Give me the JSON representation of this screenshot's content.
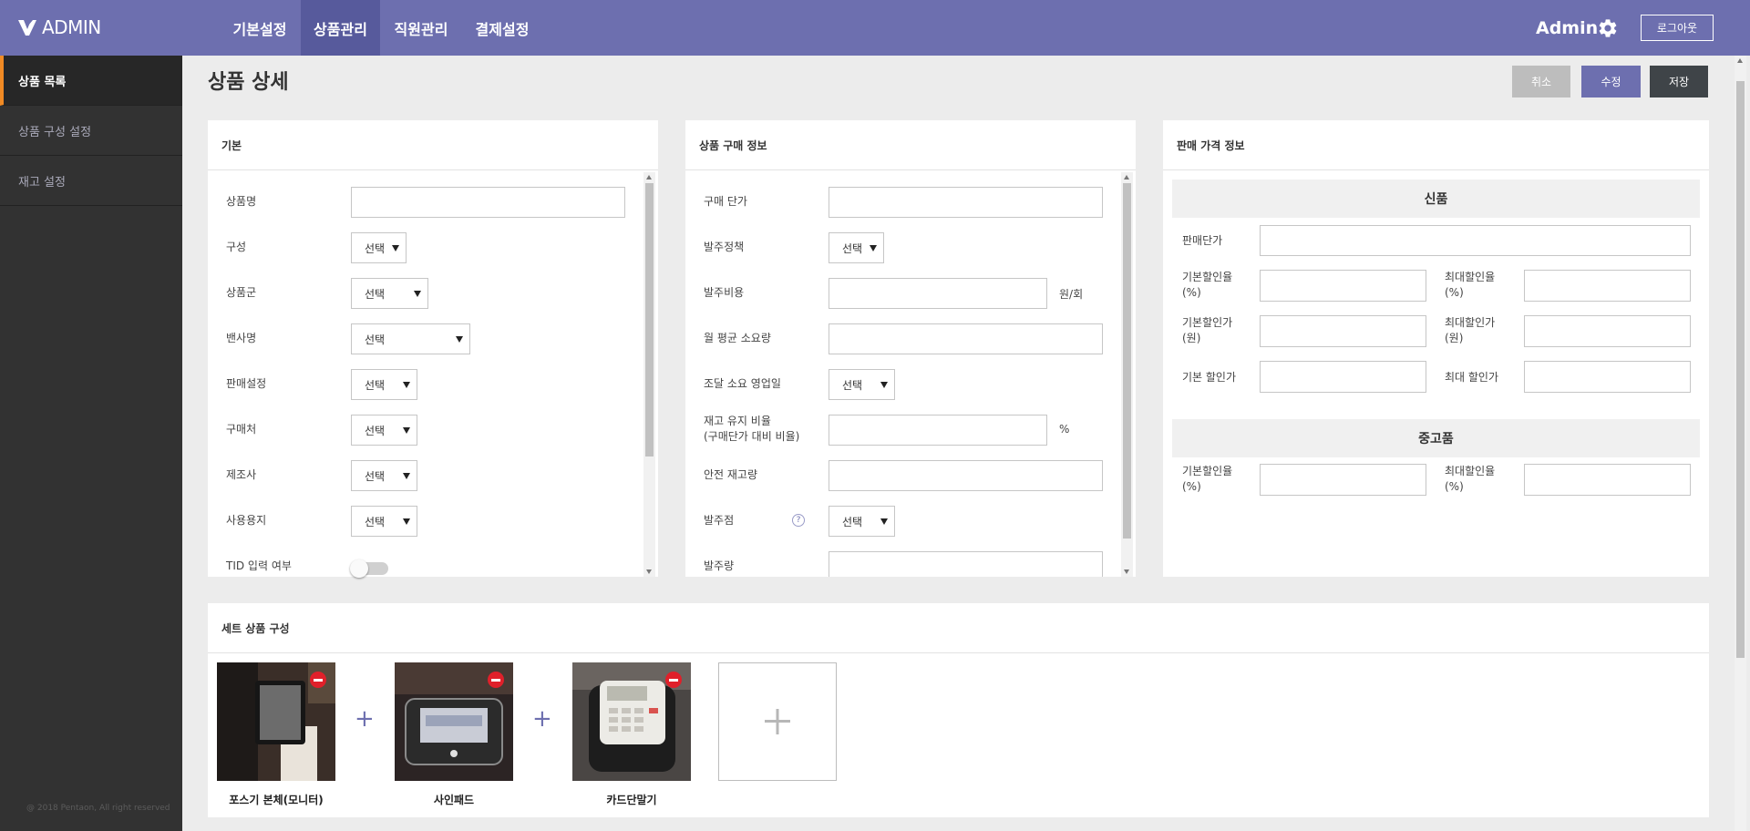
{
  "header": {
    "logo_text": "ADMIN",
    "nav": [
      {
        "label": "기본설정"
      },
      {
        "label": "상품관리"
      },
      {
        "label": "직원관리"
      },
      {
        "label": "결제설정"
      }
    ],
    "active_nav": "상품관리",
    "user_name": "Admin",
    "logout_label": "로그아웃",
    "colors": {
      "topbar": "#6d6faf",
      "active_nav": "#575a9c"
    }
  },
  "sidebar": {
    "items": [
      {
        "label": "상품 목록"
      },
      {
        "label": "상품 구성 설정"
      },
      {
        "label": "재고 설정"
      }
    ],
    "active_item": "상품 목록",
    "accent_color": "#f08a24",
    "copyright": "@ 2018 Pentaon, All right reserved"
  },
  "page": {
    "title": "상품 상세",
    "buttons": {
      "cancel": "취소",
      "edit": "수정",
      "save": "저장"
    },
    "button_colors": {
      "cancel": "#bdbdbd",
      "edit": "#6d6faf",
      "save": "#3f4448"
    }
  },
  "basic": {
    "title": "기본",
    "name_label": "상품명",
    "composition_label": "구성",
    "group_label": "상품군",
    "vendor_label": "밴사명",
    "sale_label": "판매설정",
    "purchase_label": "구매처",
    "maker_label": "제조사",
    "usage_label": "사용용지",
    "tid_label": "TID 입력 여부",
    "select_placeholder": "선택",
    "tid_enabled": false
  },
  "purchase": {
    "title": "상품 구매 정보",
    "unit_price_label": "구매 단가",
    "order_policy_label": "발주정책",
    "order_cost_label": "발주비용",
    "order_cost_unit": "원/회",
    "monthly_usage_label": "월 평균 소요량",
    "lead_days_label": "조달 소요 영업일",
    "stock_ratio_label_1": "재고 유지 비율",
    "stock_ratio_label_2": "(구매단가 대비 비율)",
    "stock_ratio_unit": "%",
    "safety_stock_label": "안전 재고량",
    "order_point_label": "발주점",
    "help_icon": "?",
    "order_qty_label": "발주량",
    "select_placeholder": "선택"
  },
  "pricing": {
    "title": "판매 가격 정보",
    "new_section": "신품",
    "sale_price_label": "판매단가",
    "base_rate_label_1": "기본할인율",
    "max_rate_label_1": "최대할인율",
    "rate_unit": "(%)",
    "base_amount_label_1": "기본할인가",
    "max_amount_label_1": "최대할인가",
    "amount_unit": "(원)",
    "base_price_label": "기본 할인가",
    "max_price_label": "최대 할인가",
    "used_section": "중고품"
  },
  "set": {
    "title": "세트 상품 구성",
    "plus_sign": "+",
    "products": [
      {
        "name": "포스기 본체(모니터)",
        "icon": "monitor-photo"
      },
      {
        "name": "사인패드",
        "icon": "signpad-photo"
      },
      {
        "name": "카드단말기",
        "icon": "card-terminal-photo"
      }
    ],
    "add_icon": "plus-icon"
  }
}
